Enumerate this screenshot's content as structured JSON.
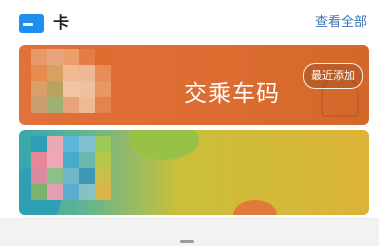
{
  "header": {
    "icon": "card-icon",
    "title": "卡",
    "view_all": "查看全部"
  },
  "cards": [
    {
      "title": "交乘车码",
      "badge": "最近添加",
      "color": "#dd6c31"
    },
    {
      "title": "",
      "color": "#dcb338"
    }
  ],
  "colors": {
    "accent": "#1e8ff0",
    "link": "#3b73b8"
  }
}
